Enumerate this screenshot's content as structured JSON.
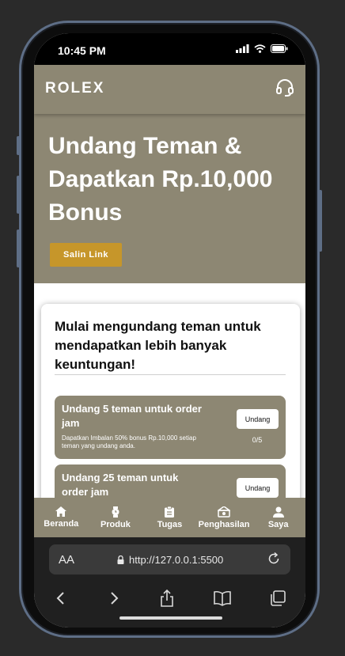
{
  "status": {
    "time": "10:45 PM"
  },
  "header": {
    "logo": "ROLEX"
  },
  "hero": {
    "title": "Undang Teman & Dapatkan Rp.10,000 Bonus",
    "copy_button": "Salin Link"
  },
  "card": {
    "heading": "Mulai mengundang teman untuk mendapatkan lebih banyak keuntungan!",
    "tasks": [
      {
        "title": "Undang 5 teman untuk order jam",
        "description": "Dapatkan Imbalan 50% bonus Rp.10,000 setiap teman yang undang anda.",
        "button": "Undang",
        "progress": "0/5"
      },
      {
        "title": "Undang 25 teman untuk order jam",
        "button": "Undang"
      }
    ]
  },
  "tabs": [
    {
      "label": "Beranda",
      "icon": "home-icon"
    },
    {
      "label": "Produk",
      "icon": "watch-icon"
    },
    {
      "label": "Tugas",
      "icon": "clipboard-icon"
    },
    {
      "label": "Penghasilan",
      "icon": "money-icon"
    },
    {
      "label": "Saya",
      "icon": "user-icon"
    }
  ],
  "browser": {
    "text_size_label": "AA",
    "url": "http://127.0.0.1:5500"
  },
  "colors": {
    "brand": "#8d8773",
    "accent": "#c6962a",
    "phone_frame": "#5e6e86"
  }
}
